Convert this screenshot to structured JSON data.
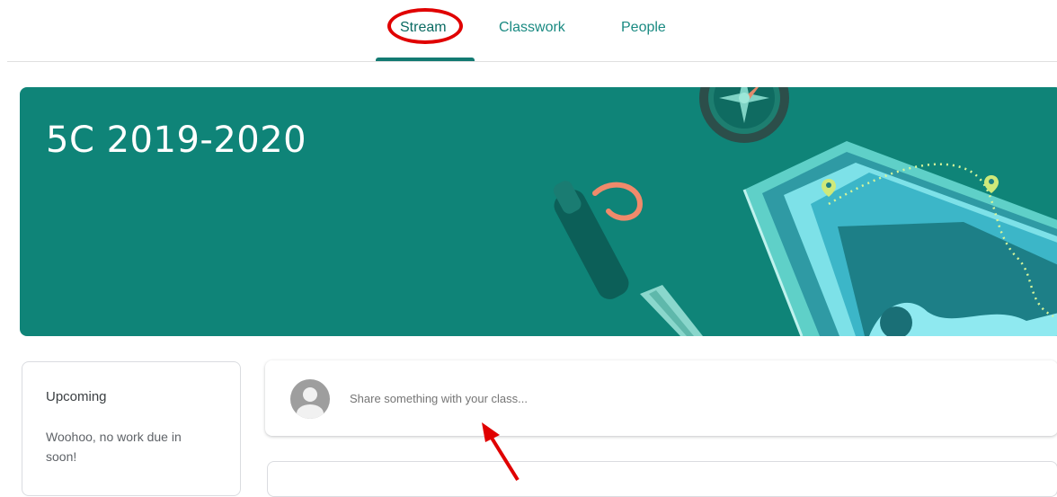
{
  "nav": {
    "tabs": [
      {
        "label": "Stream",
        "active": true
      },
      {
        "label": "Classwork",
        "active": false
      },
      {
        "label": "People",
        "active": false
      }
    ]
  },
  "banner": {
    "title": "5C 2019-2020",
    "color": "#0f8478"
  },
  "upcoming": {
    "title": "Upcoming",
    "text": "Woohoo, no work due in soon!"
  },
  "stream": {
    "share_placeholder": "Share something with your class..."
  },
  "annotations": {
    "highlight_color": "#e00000",
    "icons": [
      "avatar-icon",
      "compass-icon",
      "location-pin-icon"
    ]
  }
}
